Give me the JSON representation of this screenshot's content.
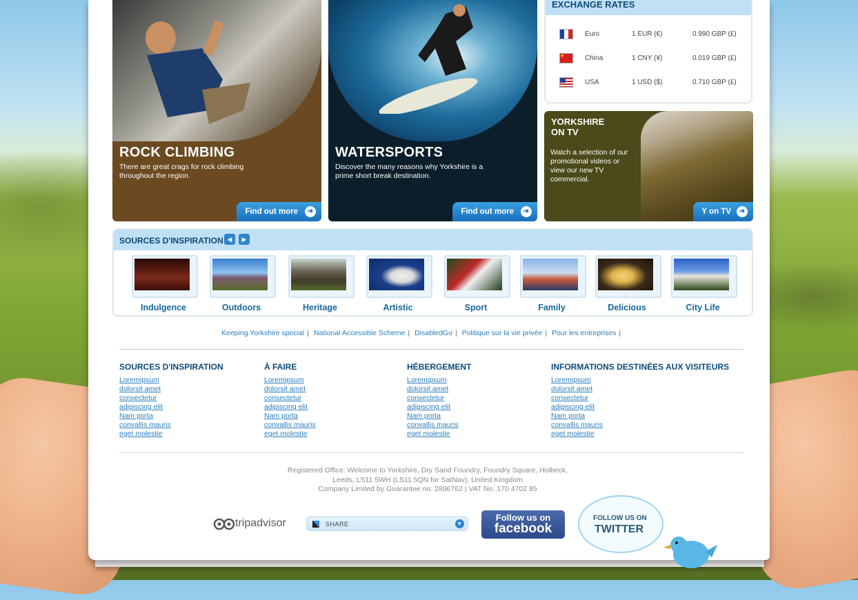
{
  "features": [
    {
      "title": "ROCK CLIMBING",
      "desc": "There are great crags for rock climbing throughout the region.",
      "button": "Find out more",
      "color": "#6b4a22"
    },
    {
      "title": "WATERSPORTS",
      "desc": "Discover the many reasons why Yorkshire is a prime short break destination.",
      "button": "Find out more",
      "color": "#0b1e2a"
    }
  ],
  "exchange": {
    "title": "EXCHANGE RATES",
    "rows": [
      {
        "name": "Euro",
        "from": "1 EUR (€)",
        "to": "0.990 GBP (£)",
        "flag": "france-flag-icon"
      },
      {
        "name": "China",
        "from": "1 CNY (¥)",
        "to": "0.019 GBP (£)",
        "flag": "china-flag-icon"
      },
      {
        "name": "USA",
        "from": "1 USD ($)",
        "to": "0.710 GBP (£)",
        "flag": "usa-flag-icon"
      }
    ]
  },
  "tv": {
    "title": "YORKSHIRE ON TV",
    "desc": "Watch a selection of our promotional videos or view our new TV commercial.",
    "button": "Y on TV"
  },
  "inspiration": {
    "title": "SOURCES D'INSPIRATION",
    "items": [
      "Indulgence",
      "Outdoors",
      "Heritage",
      "Artistic",
      "Sport",
      "Family",
      "Delicious",
      "City Life"
    ]
  },
  "footer_links": [
    "Keeping Yorkshire special",
    "National Accessible Scheme",
    "DisabledGo",
    "Politique sur la vie privée",
    "Pour les entreprises"
  ],
  "columns": [
    {
      "heading": "SOURCES D'INSPIRATION",
      "links": [
        "Loremipsum",
        "dolorsit amet",
        "consectetur",
        "adipiscing elit",
        "Nam porta",
        "convallis mauris",
        "eget molestie"
      ]
    },
    {
      "heading": "À FAIRE",
      "links": [
        "Loremipsum",
        "dolorsit amet",
        "consectetur",
        "adipiscing elit",
        "Nam porta",
        "convallis mauris",
        "eget molestie"
      ]
    },
    {
      "heading": "HÉBERGEMENT",
      "links": [
        "Loremipsum",
        "dolorsit amet",
        "consectetur",
        "adipiscing elit",
        "Nam porta",
        "convallis mauris",
        "eget molestie"
      ]
    },
    {
      "heading": "INFORMATIONS DESTINÉES AUX VISITEURS",
      "links": [
        "Loremipsum",
        "dolorsit amet",
        "consectetur",
        "adipiscing elit",
        "Nam porta",
        "convallis mauris",
        "eget molestie"
      ]
    }
  ],
  "address": {
    "line1": "Registered Office: Welcome to Yorkshire, Dry Sand Foundry, Foundry Square, Holbeck,",
    "line2": "Leeds, LS11 5WH (LS11 5QN for SatNav), United Kingdom",
    "line3": "Company Limited by Guarantee no: 2896762 | VAT No: 170 4702 85"
  },
  "social": {
    "tripadvisor": "tripadvisor",
    "share": "SHARE",
    "facebook_top": "Follow us on",
    "facebook_bottom": "facebook",
    "twitter_top": "FOLLOW US ON",
    "twitter_bottom": "TWITTER"
  }
}
